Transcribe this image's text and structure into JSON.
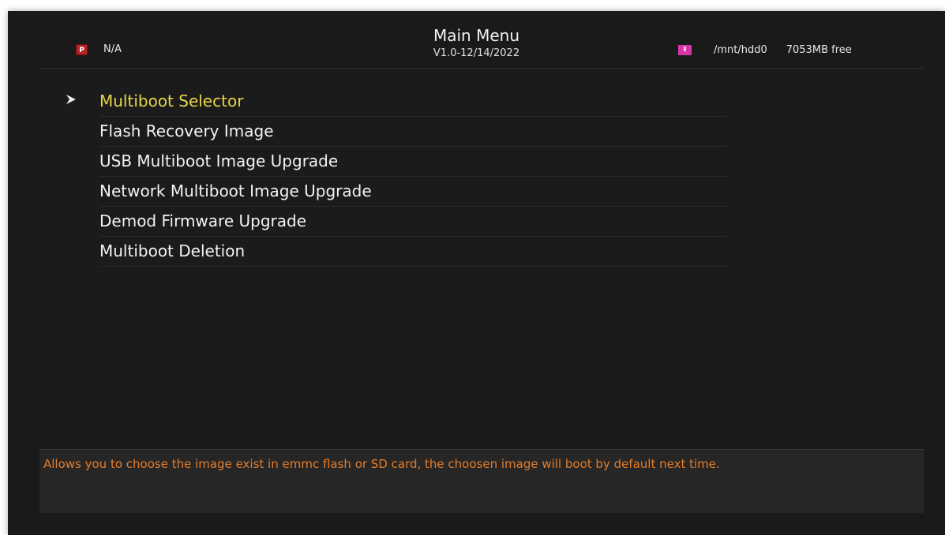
{
  "header": {
    "title": "Main Menu",
    "version": "V1.0-12/14/2022",
    "left_status": "N/A",
    "rec_icon": "recording-icon",
    "rec_icon_glyph": "P",
    "storage_icon": "hdd-icon",
    "mount_path": "/mnt/hdd0",
    "free_space": "7053MB free"
  },
  "menu": {
    "items": [
      {
        "label": "Multiboot Selector",
        "selected": true
      },
      {
        "label": "Flash Recovery Image",
        "selected": false
      },
      {
        "label": "USB Multiboot Image Upgrade",
        "selected": false
      },
      {
        "label": "Network Multiboot Image Upgrade",
        "selected": false
      },
      {
        "label": "Demod Firmware Upgrade",
        "selected": false
      },
      {
        "label": "Multiboot Deletion",
        "selected": false
      }
    ],
    "selected_index": 0
  },
  "help": {
    "text": "Allows you to choose the image exist in emmc flash or SD card, the choosen image will boot by default next time."
  },
  "colors": {
    "background": "#1a1a1a",
    "selected_text": "#e8d44a",
    "help_text": "#e47d2a",
    "rec_icon": "#b8232a",
    "hdd_icon": "#d636a8"
  }
}
